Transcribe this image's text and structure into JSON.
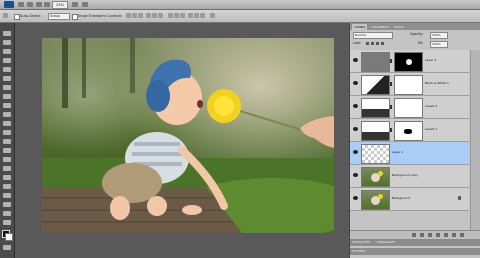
{
  "app": {
    "zoom": "25%",
    "colors": {
      "brand": "#1f4e8c",
      "selection": "#a9cdf6",
      "panel": "#c4c4c4"
    }
  },
  "options": {
    "auto_select_label": "Auto-Select:",
    "auto_select_value": "Group",
    "show_transform_label": "Show Transform Controls"
  },
  "panel": {
    "tabs": [
      "LAYERS",
      "CHANNELS",
      "PATHS"
    ],
    "blend_mode": "Normal",
    "opacity_label": "Opacity:",
    "opacity_value": "100%",
    "lock_label": "Lock:",
    "fill_label": "Fill:",
    "fill_value": "100%",
    "layers": [
      {
        "name": "Layer 2",
        "thumb": "gray",
        "mask": "dark-spot",
        "selected": false
      },
      {
        "name": "Black & White 1",
        "thumb": "adjust",
        "mask": "white",
        "selected": false
      },
      {
        "name": "Levels 2",
        "thumb": "adjust",
        "mask": "white",
        "selected": false
      },
      {
        "name": "Levels 1",
        "thumb": "adjust",
        "mask": "spot",
        "selected": false
      },
      {
        "name": "Layer 1",
        "thumb": "checker",
        "mask": "none",
        "selected": true
      },
      {
        "name": "Background copy",
        "thumb": "photo",
        "mask": "none",
        "selected": false
      },
      {
        "name": "Background",
        "thumb": "photo",
        "mask": "none",
        "selected": false,
        "locked": true
      }
    ],
    "bottom_tabs": [
      "CHARACTER",
      "PARAGRAPH"
    ],
    "actions_tab": "ACTIONS"
  },
  "icons": {
    "tools": [
      "move-tool-icon",
      "marquee-tool-icon",
      "lasso-tool-icon",
      "quick-select-tool-icon",
      "crop-tool-icon",
      "eyedropper-tool-icon",
      "healing-tool-icon",
      "brush-tool-icon",
      "clone-stamp-tool-icon",
      "history-brush-tool-icon",
      "eraser-tool-icon",
      "gradient-tool-icon",
      "blur-tool-icon",
      "dodge-tool-icon",
      "pen-tool-icon",
      "type-tool-icon",
      "path-select-tool-icon",
      "shape-tool-icon",
      "3d-rotate-tool-icon",
      "3d-orbit-tool-icon",
      "hand-tool-icon",
      "zoom-tool-icon"
    ]
  }
}
